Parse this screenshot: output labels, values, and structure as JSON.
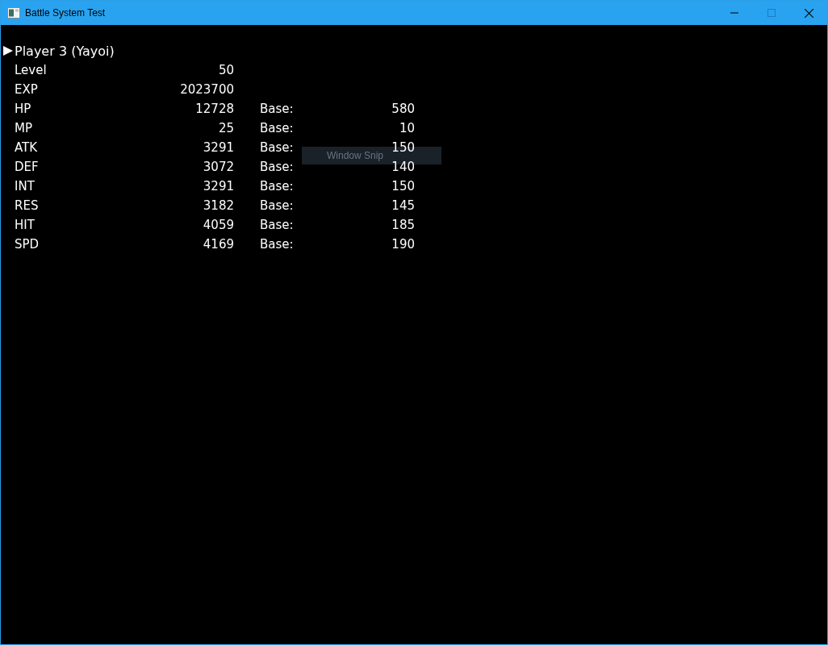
{
  "window": {
    "title": "Battle System Test"
  },
  "character": {
    "name": "Player 3 (Yayoi)"
  },
  "stats": [
    {
      "label": "Level",
      "value": "50"
    },
    {
      "label": "EXP",
      "value": "2023700"
    },
    {
      "label": "HP",
      "value": "12728",
      "base_label": "Base:",
      "base": "580"
    },
    {
      "label": "MP",
      "value": "25",
      "base_label": "Base:",
      "base": "10"
    },
    {
      "label": "ATK",
      "value": "3291",
      "base_label": "Base:",
      "base": "150"
    },
    {
      "label": "DEF",
      "value": "3072",
      "base_label": "Base:",
      "base": "140"
    },
    {
      "label": "INT",
      "value": "3291",
      "base_label": "Base:",
      "base": "150"
    },
    {
      "label": "RES",
      "value": "3182",
      "base_label": "Base:",
      "base": "145"
    },
    {
      "label": "HIT",
      "value": "4059",
      "base_label": "Base:",
      "base": "185"
    },
    {
      "label": "SPD",
      "value": "4169",
      "base_label": "Base:",
      "base": "190"
    }
  ],
  "tooltip": {
    "text": "Window Snip"
  }
}
